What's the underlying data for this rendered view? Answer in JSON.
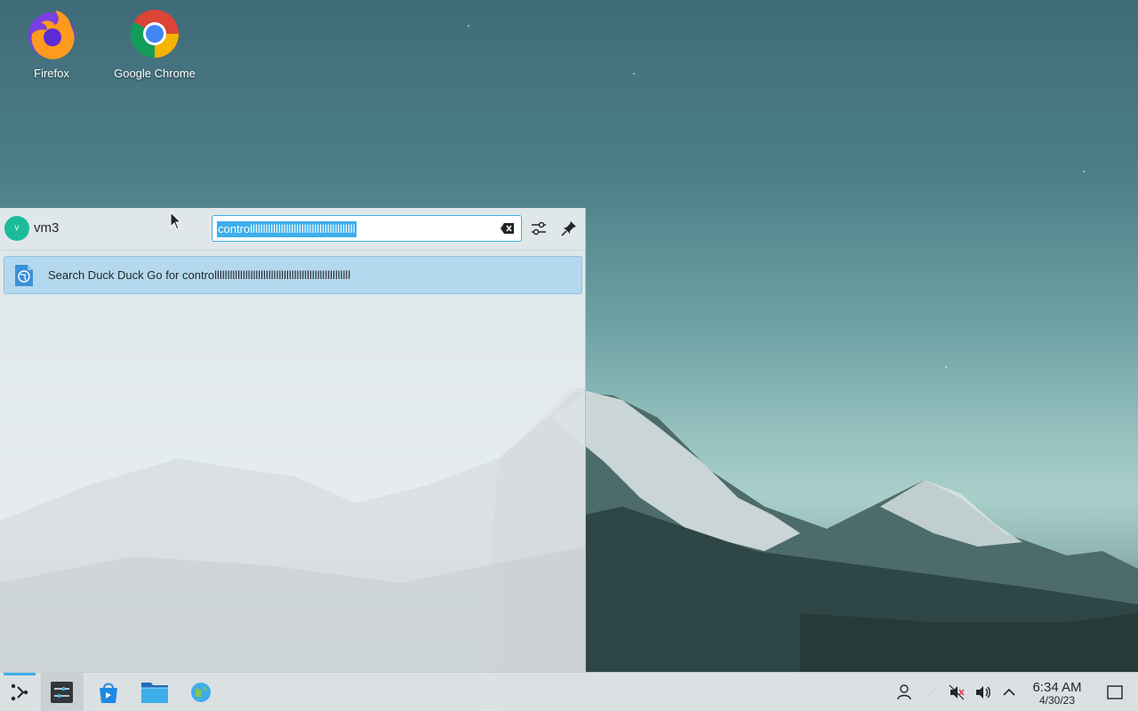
{
  "desktop": {
    "icons": [
      {
        "label": "Firefox"
      },
      {
        "label": "Google Chrome"
      }
    ]
  },
  "launcher": {
    "username": "vm3",
    "avatar_letter": "v",
    "search_value": "controlllllllllllllllllllllllllllllllllllllllll",
    "results": [
      {
        "label": "Search Duck Duck Go for controlllllllllllllllllllllllllllllllllllllllllllllllllllll"
      }
    ]
  },
  "taskbar": {
    "clock_time": "6:34 AM",
    "clock_date": "4/30/23"
  },
  "colors": {
    "accent": "#3daee9",
    "avatar": "#1abc9c",
    "result_highlight": "#b4d8ed"
  }
}
